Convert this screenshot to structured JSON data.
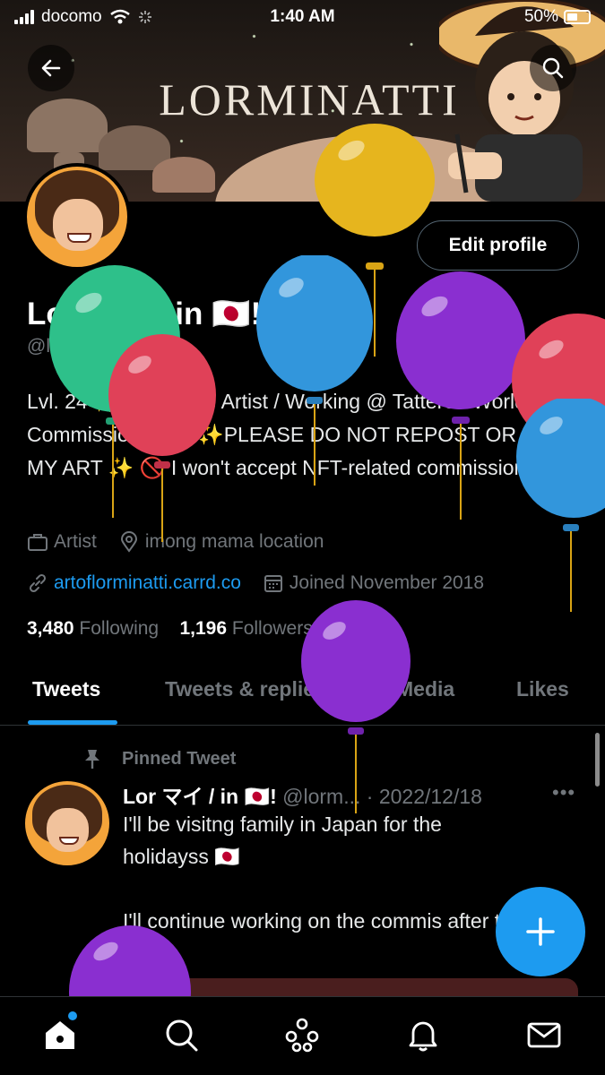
{
  "status_bar": {
    "carrier": "docomo",
    "time": "1:40 AM",
    "battery": "50%"
  },
  "banner": {
    "title": "LORMINATTI"
  },
  "profile": {
    "edit_label": "Edit profile",
    "display_name": "Lor マイ / in 🇯🇵!",
    "handle": "@lorminatti",
    "bio": "Lvl. 24 ✨ Freelance Artist / Working @ Tattered Worlds ✨ Commission me ~ ✨PLEASE DO NOT REPOST OR USE MY ART ✨ 🚫 I won't accept NFT-related commissions",
    "profession": "Artist",
    "location": "imong mama location",
    "website": "artoflorminatti.carrd.co",
    "joined": "Joined November 2018",
    "following_count": "3,480",
    "following_label": "Following",
    "followers_count": "1,196",
    "followers_label": "Followers"
  },
  "tabs": [
    {
      "label": "Tweets"
    },
    {
      "label": "Tweets & replies"
    },
    {
      "label": "Media"
    },
    {
      "label": "Likes"
    }
  ],
  "pinned": {
    "label": "Pinned Tweet",
    "name": "Lor マイ / in 🇯🇵!",
    "handle_date": "@lorm... · 2022/12/18",
    "more": "•••",
    "text": "I'll be visitng family in Japan for the holidayss 🇯🇵\n\nI'll continue working on the commis after the 21st !"
  },
  "icons": {
    "back": "arrow-left-icon",
    "search": "search-icon",
    "compose": "plus-icon",
    "nav": [
      "home-icon",
      "search-icon",
      "spaces-icon",
      "bell-icon",
      "mail-icon"
    ]
  },
  "colors": {
    "accent": "#1d9bf0",
    "background": "#000000",
    "muted": "#71767b"
  }
}
